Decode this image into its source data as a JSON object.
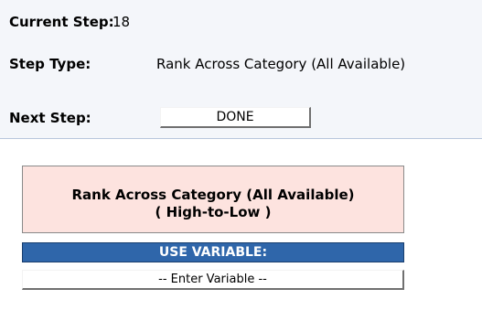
{
  "step_info": {
    "current_step_label": "Current Step:",
    "current_step_value": "18",
    "step_type_label": "Step Type:",
    "step_type_value": "Rank Across Category (All Available)",
    "next_step_label": "Next Step:",
    "next_step_button": "DONE"
  },
  "rank_panel": {
    "title_line1": "Rank Across Category (All Available)",
    "title_line2": "( High-to-Low )"
  },
  "variable": {
    "header": "USE VARIABLE:",
    "enter_button": "-- Enter Variable --"
  },
  "colors": {
    "top_panel_bg": "#f4f6fa",
    "rank_box_bg": "#fde3df",
    "use_variable_bar": "#2f66aa"
  }
}
